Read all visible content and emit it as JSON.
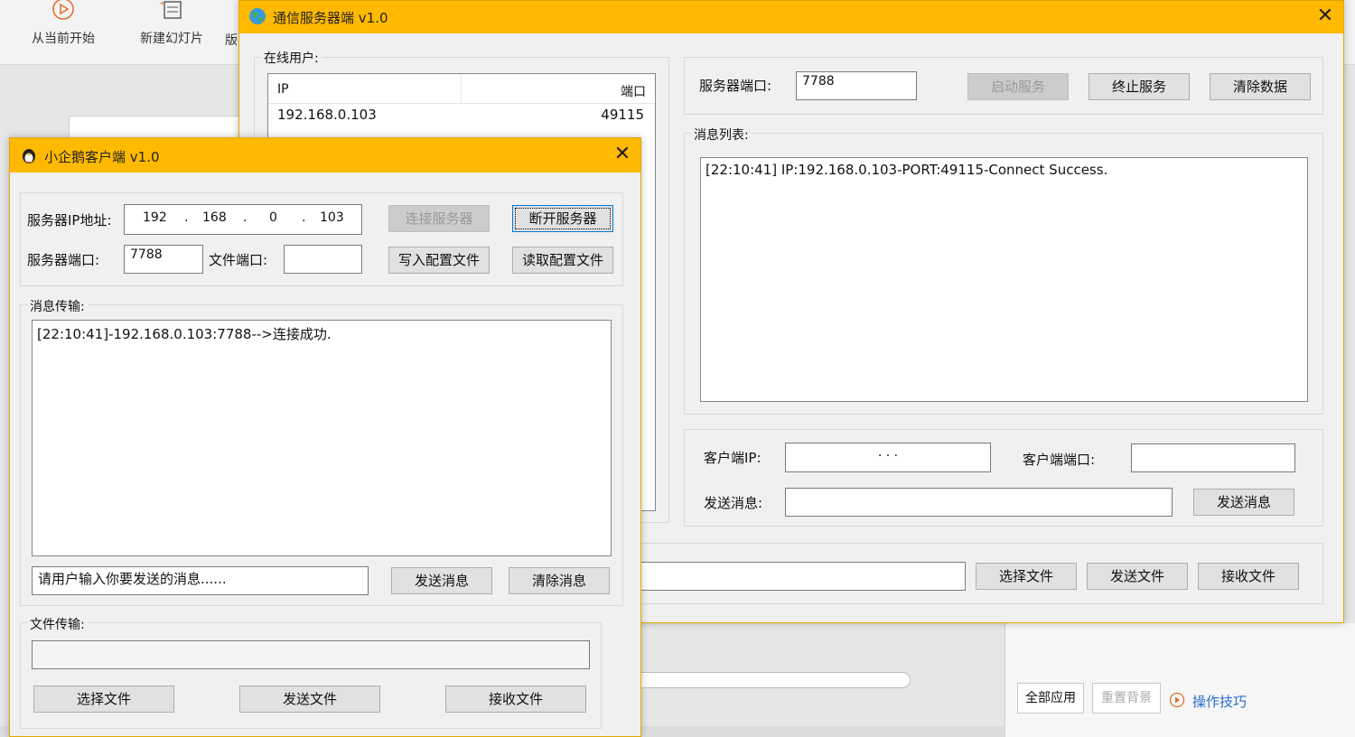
{
  "background_app": {
    "ribbon": {
      "from_current_label": "从当前开始",
      "new_slide_label": "新建幻灯片",
      "partial_label": "版"
    },
    "right_panel": {
      "apply_all_label": "全部应用",
      "reset_bg_label": "重置背景",
      "tips_label": "操作技巧"
    }
  },
  "server": {
    "title": "通信服务器端 v1.0",
    "online_users_label": "在线用户:",
    "columns": [
      "IP",
      "端口"
    ],
    "rows": [
      {
        "ip": "192.168.0.103",
        "port": "49115"
      }
    ],
    "server_port_label": "服务器端口:",
    "server_port_value": "7788",
    "start_label": "启动服务",
    "stop_label": "终止服务",
    "clear_label": "清除数据",
    "message_list_label": "消息列表:",
    "messages": [
      "[22:10:41] IP:192.168.0.103-PORT:49115-Connect Success."
    ],
    "client_ip_label": "客户端IP:",
    "client_ip_dots": ".          .          .",
    "client_port_label": "客户端端口:",
    "send_msg_label": "发送消息:",
    "send_msg_button": "发送消息",
    "select_file_button": "选择文件",
    "send_file_button": "发送文件",
    "receive_file_button": "接收文件"
  },
  "client": {
    "title": "小企鹅客户端 v1.0",
    "server_ip_label": "服务器IP地址:",
    "ip_octets": [
      "192",
      "168",
      "0",
      "103"
    ],
    "connect_label": "连接服务器",
    "disconnect_label": "断开服务器",
    "server_port_label": "服务器端口:",
    "server_port_value": "7788",
    "file_port_label": "文件端口:",
    "file_port_value": "",
    "write_config_label": "写入配置文件",
    "read_config_label": "读取配置文件",
    "message_transfer_label": "消息传输:",
    "log": "[22:10:41]-192.168.0.103:7788-->连接成功.",
    "input_placeholder": "请用户输入你要发送的消息......",
    "send_label": "发送消息",
    "clear_label": "清除消息",
    "file_transfer_label": "文件传输:",
    "select_file_label": "选择文件",
    "send_file_label": "发送文件",
    "receive_file_label": "接收文件"
  },
  "colors": {
    "titlebar": "#ffb900",
    "window_bg": "#f0f0f0",
    "focus_border": "#0078d7"
  }
}
